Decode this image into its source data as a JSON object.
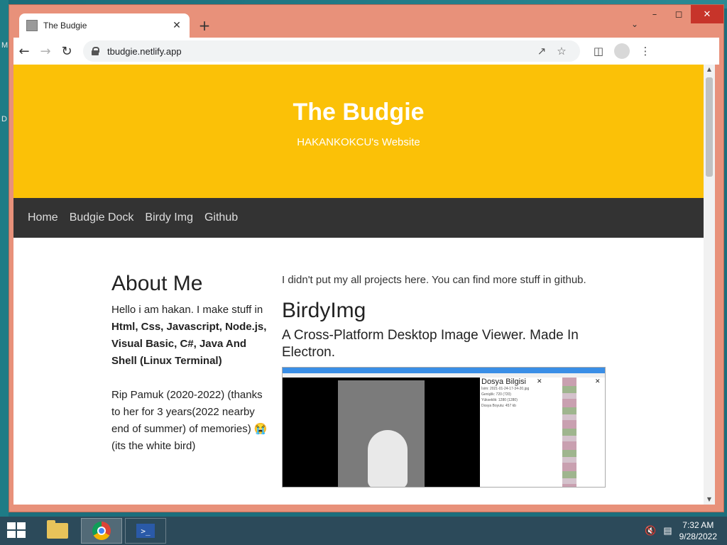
{
  "desktop": {
    "glyph_1": "M",
    "glyph_2": "D"
  },
  "browser": {
    "tab_title": "The Budgie",
    "url": "tbudgie.netlify.app"
  },
  "site": {
    "title": "The Budgie",
    "subtitle": "HAKANKOKCU's Website",
    "nav": [
      "Home",
      "Budgie Dock",
      "Birdy Img",
      "Github"
    ],
    "about": {
      "heading": "About Me",
      "intro": "Hello i am hakan. I make stuff in ",
      "skills": "Html, Css, Javascript, Node.js, Visual Basic, C#, Java And Shell (Linux Terminal)",
      "rip_text": "Rip Pamuk (2020-2022) (thanks to her for 3 years(2022 nearby end of summer) of memories) 😭 (its the white bird)"
    },
    "projects": {
      "note": "I didn't put my all projects here. You can find more stuff in github.",
      "name": "BirdyImg",
      "description": "A Cross-Platform Desktop Image Viewer. Made In Electron."
    },
    "screenshot_panel": {
      "title": "Dosya Bilgisi",
      "lines": [
        "İsim: 2021-01-24-17-34-20.jpg",
        "Genişlik: 720 (720)",
        "Yükseklik: 1280 (1280)",
        "Dosya Boyutu: 457 kb"
      ]
    }
  },
  "taskbar": {
    "time": "7:32 AM",
    "date": "9/28/2022"
  },
  "colors": {
    "hero": "#fbc107",
    "nav": "#333333",
    "window_frame": "#e8917a"
  }
}
